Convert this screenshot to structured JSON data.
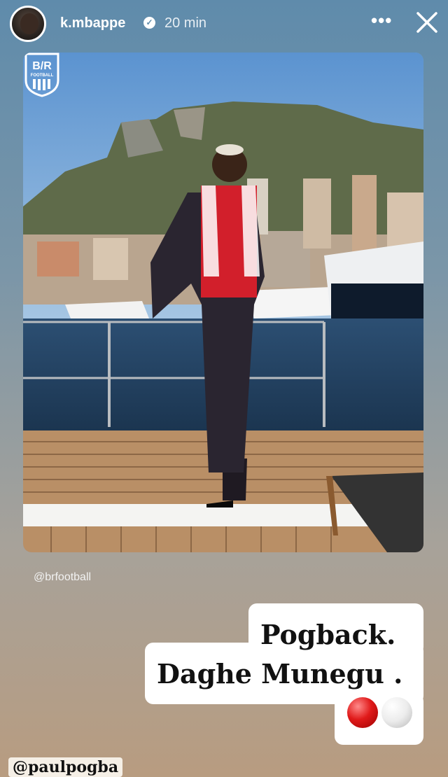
{
  "header": {
    "username": "k.mbappe",
    "time": "20 min",
    "more_label": "•••",
    "verified_glyph": "✓"
  },
  "photo": {
    "logo_text": "B/R",
    "logo_sub": "FOOTBALL",
    "credit": "@brfootball"
  },
  "sticker": {
    "line1": "Pogback.",
    "line2": "Daghe Munegu ."
  },
  "mention": "@paulpogba",
  "colors": {
    "accent_red": "#e01a1a",
    "text_white": "#ffffff"
  }
}
